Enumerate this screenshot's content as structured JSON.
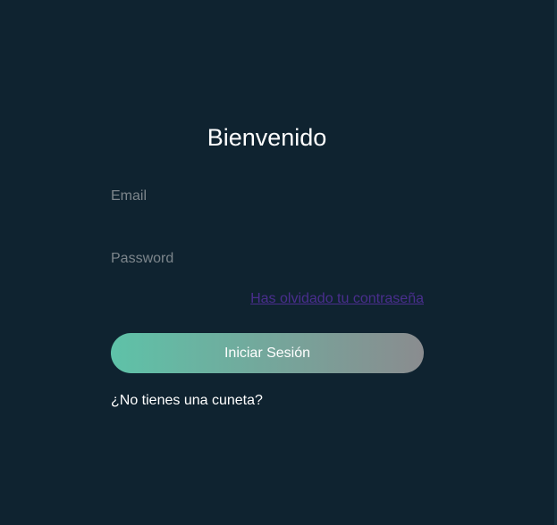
{
  "login": {
    "title": "Bienvenido",
    "email_placeholder": "Email",
    "password_placeholder": "Password",
    "forgot_password_label": "Has olvidado tu contraseña",
    "submit_label": "Iniciar Sesión",
    "signup_label": "¿No tienes una cuneta?"
  },
  "colors": {
    "background": "#0f2330",
    "button_gradient_start": "#5ec2a8",
    "button_gradient_end": "#8a8c8f",
    "link": "#4a2e8e"
  }
}
